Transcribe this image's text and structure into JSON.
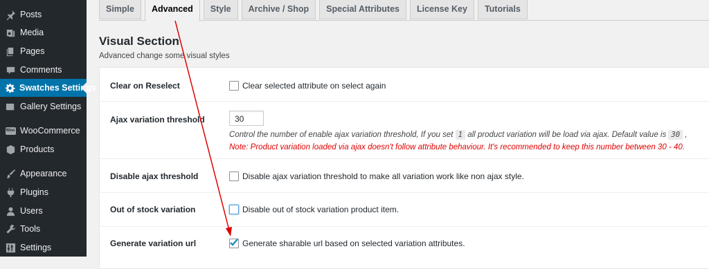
{
  "sidebar": {
    "items": [
      {
        "label": "Posts",
        "icon": "pushpin-icon"
      },
      {
        "label": "Media",
        "icon": "media-icon"
      },
      {
        "label": "Pages",
        "icon": "pages-icon"
      },
      {
        "label": "Comments",
        "icon": "comment-bubble-icon"
      },
      {
        "label": "Swatches Settings",
        "icon": "gear-icon",
        "active": true
      },
      {
        "label": "Gallery Settings",
        "icon": "gallery-icon"
      },
      {
        "label": "WooCommerce",
        "icon": "woocommerce-icon",
        "badge": "Woo"
      },
      {
        "label": "Products",
        "icon": "product-box-icon"
      },
      {
        "label": "Appearance",
        "icon": "paintbrush-icon"
      },
      {
        "label": "Plugins",
        "icon": "plugin-icon"
      },
      {
        "label": "Users",
        "icon": "user-icon"
      },
      {
        "label": "Tools",
        "icon": "wrench-icon"
      },
      {
        "label": "Settings",
        "icon": "settings-sliders-icon"
      }
    ]
  },
  "tabs": [
    {
      "label": "Simple"
    },
    {
      "label": "Advanced",
      "active": true
    },
    {
      "label": "Style"
    },
    {
      "label": "Archive / Shop"
    },
    {
      "label": "Special Attributes"
    },
    {
      "label": "License Key"
    },
    {
      "label": "Tutorials"
    }
  ],
  "section": {
    "title": "Visual Section",
    "description": "Advanced change some visual styles"
  },
  "settings": {
    "clear_on_reselect": {
      "label": "Clear on Reselect",
      "checkbox_label": "Clear selected attribute on select again",
      "checked": false
    },
    "ajax_threshold": {
      "label": "Ajax variation threshold",
      "value": "30",
      "hint_part1": "Control the number of enable ajax variation threshold, If you set",
      "hint_code1": "1",
      "hint_part2": "all product variation will be load via ajax. Default value is",
      "hint_code2": "30",
      "hint_part3": ",",
      "note": "Note: Product variation loaded via ajax doesn't follow attribute behaviour. It's recommended to keep this number between 30 - 40."
    },
    "disable_ajax_threshold": {
      "label": "Disable ajax threshold",
      "checkbox_label": "Disable ajax variation threshold to make all variation work like non ajax style.",
      "checked": false
    },
    "out_of_stock": {
      "label": "Out of stock variation",
      "checkbox_label": "Disable out of stock variation product item.",
      "checked": false
    },
    "generate_url": {
      "label": "Generate variation url",
      "checkbox_label": "Generate sharable url based on selected variation attributes.",
      "checked": true
    }
  },
  "colors": {
    "sidebar_bg": "#23282d",
    "active_menu": "#0073aa",
    "note_red": "#e00000",
    "annotation_arrow": "#e00000"
  }
}
